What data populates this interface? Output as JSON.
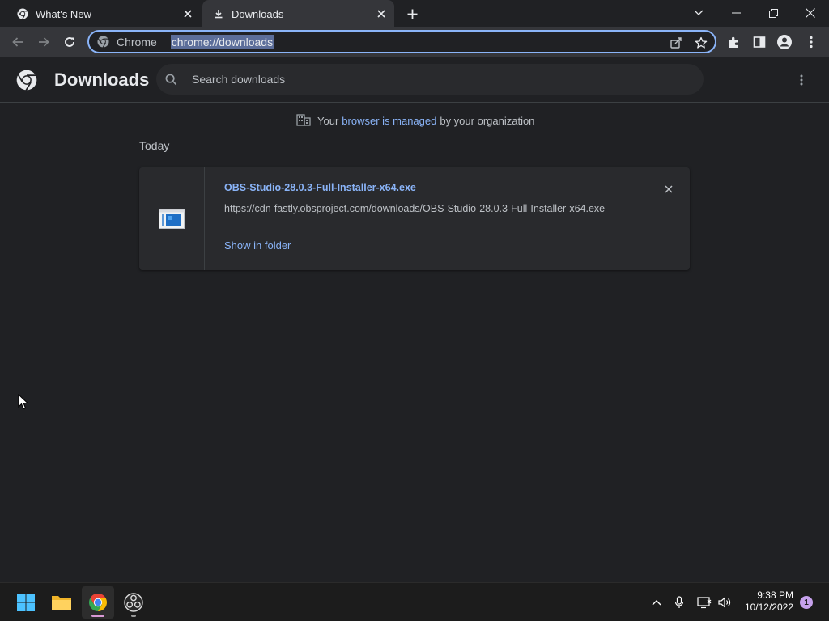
{
  "tabs": [
    {
      "title": "What's New",
      "icon": "chrome-logo-icon"
    },
    {
      "title": "Downloads",
      "icon": "download-icon"
    }
  ],
  "omnibox": {
    "chip": "Chrome",
    "url": "chrome://downloads"
  },
  "page": {
    "title": "Downloads",
    "search_placeholder": "Search downloads"
  },
  "managed_notice": {
    "prefix": "Your",
    "link": "browser is managed",
    "suffix": "by your organization"
  },
  "date_group": "Today",
  "downloads": [
    {
      "file_name": "OBS-Studio-28.0.3-Full-Installer-x64.exe",
      "url": "https://cdn-fastly.obsproject.com/downloads/OBS-Studio-28.0.3-Full-Installer-x64.exe",
      "action": "Show in folder"
    }
  ],
  "taskbar": {
    "time": "9:38 PM",
    "date": "10/12/2022",
    "notification_count": "1"
  },
  "colors": {
    "accent": "#8ab4f8",
    "background": "#202124",
    "toolbar": "#35363a",
    "card": "#292a2d"
  }
}
